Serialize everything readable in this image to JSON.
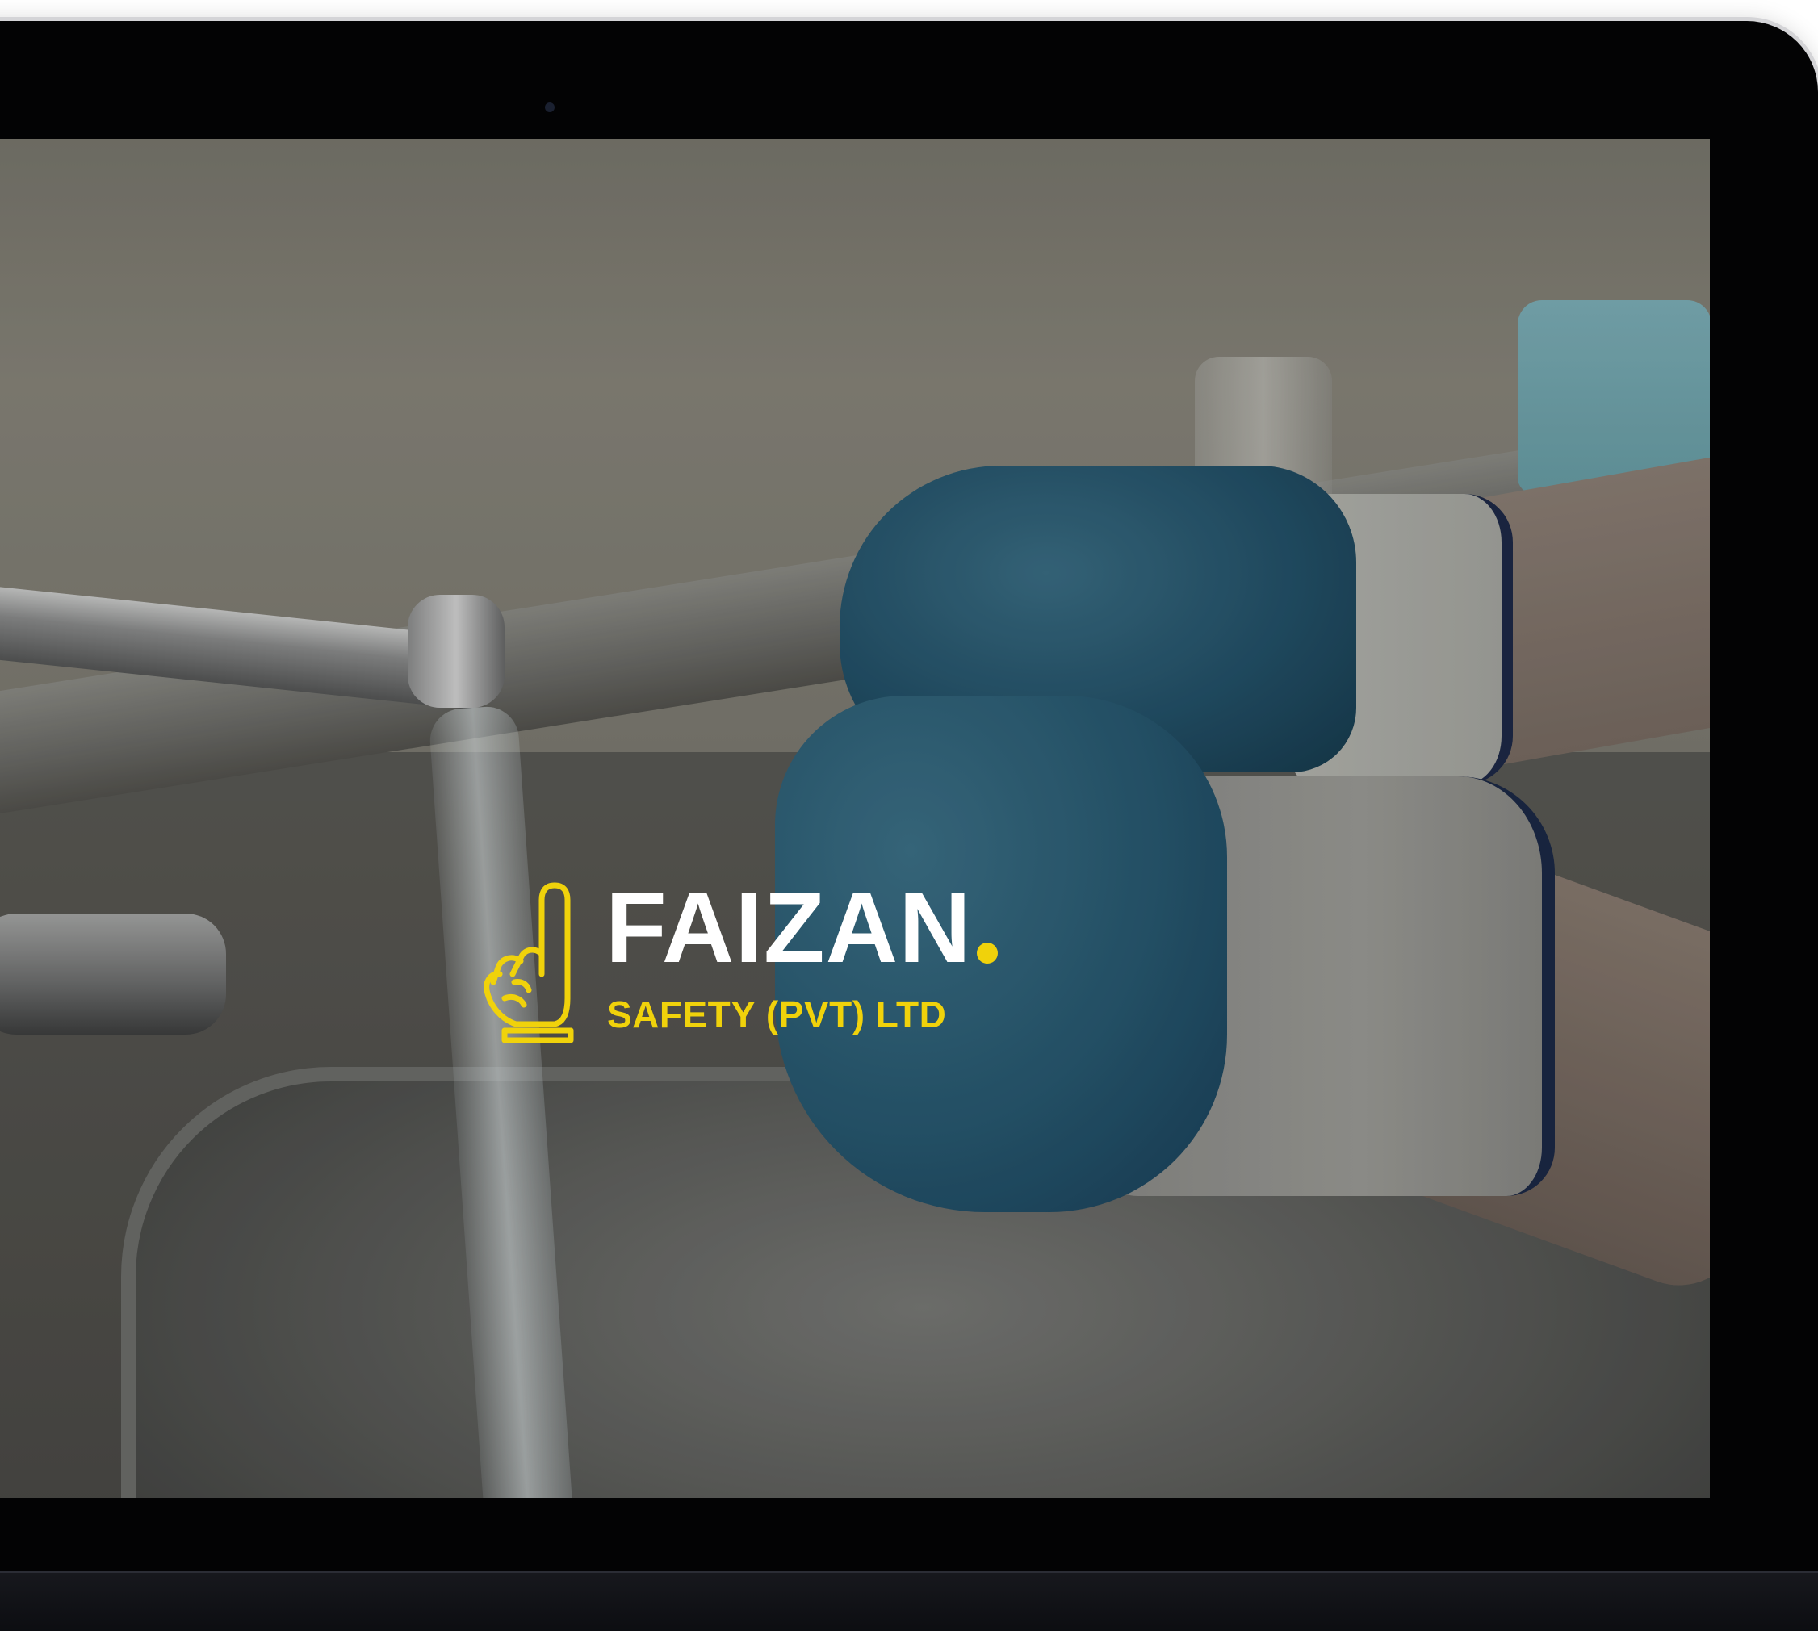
{
  "hero": {
    "brand_name": "FAIZAN",
    "tagline": "SAFETY (PVT) LTD",
    "logo_icon": "pointing-hand-icon",
    "brand_colors": {
      "accent": "#f0d20b",
      "wordmark": "#ffffff"
    }
  }
}
